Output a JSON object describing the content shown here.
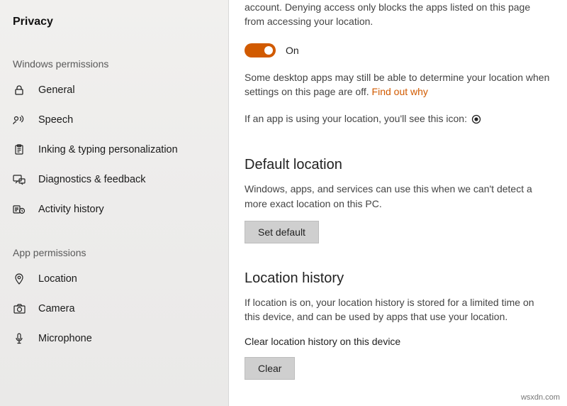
{
  "sidebar": {
    "title": "Privacy",
    "section_windows": "Windows permissions",
    "section_apps": "App permissions",
    "items_windows": [
      {
        "label": "General"
      },
      {
        "label": "Speech"
      },
      {
        "label": "Inking & typing personalization"
      },
      {
        "label": "Diagnostics & feedback"
      },
      {
        "label": "Activity history"
      }
    ],
    "items_apps": [
      {
        "label": "Location"
      },
      {
        "label": "Camera"
      },
      {
        "label": "Microphone"
      }
    ]
  },
  "main": {
    "intro_text": "account. Denying access only blocks the apps listed on this page from accessing your location.",
    "toggle": {
      "state": "On"
    },
    "desktop_apps_text": "Some desktop apps may still be able to determine your location when settings on this page are off. ",
    "find_out_why": "Find out why",
    "using_location_text": "If an app is using your location, you'll see this icon:",
    "default_location": {
      "heading": "Default location",
      "text": "Windows, apps, and services can use this when we can't detect a more exact location on this PC.",
      "button": "Set default"
    },
    "location_history": {
      "heading": "Location history",
      "text": "If location is on, your location history is stored for a limited time on this device, and can be used by apps that use your location.",
      "clear_label": "Clear location history on this device",
      "button": "Clear"
    }
  },
  "watermark": "wsxdn.com"
}
